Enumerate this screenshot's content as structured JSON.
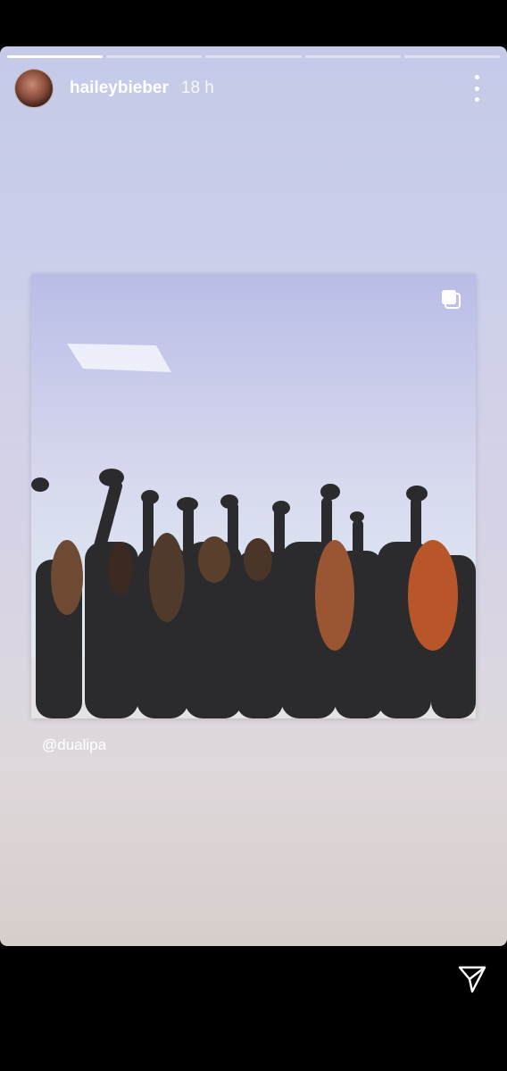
{
  "story": {
    "progress_total": 5,
    "progress_current": 1,
    "username": "haileybieber",
    "time": "18 h",
    "mention": "@dualipa",
    "media_description": "Photo of people in black coats raising hats in the air"
  },
  "icons": {
    "avatar": "profile-avatar",
    "more": "more-vertical-icon",
    "multi": "multiple-photos-icon",
    "send": "send-paper-plane-icon"
  },
  "colors": {
    "story_bg_top": "#c4cae8",
    "story_bg_bottom": "#d6ceca",
    "text": "#ffffff",
    "chrome": "#000000"
  }
}
